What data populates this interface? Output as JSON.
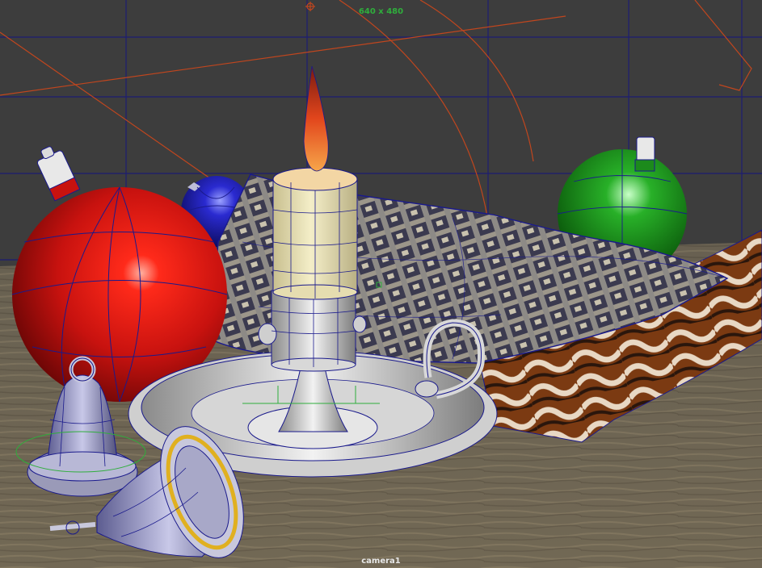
{
  "viewport": {
    "resolution_gate_label": "640 x 480",
    "camera_label": "camera1"
  },
  "colors": {
    "background": "#3d3d3d",
    "grid": "#1d1d73",
    "wireframe": "#1a1a8c",
    "orange_curves": "#c0461e",
    "ornament_red": "#c8120f",
    "ornament_blue": "#2222b8",
    "ornament_green": "#1a8a1a",
    "candle_wax": "#efe6b8",
    "flame": "#e2461c",
    "floor_wood": "#6b6252",
    "metal": "#e4e4e4"
  },
  "scene_objects": [
    "red-ornament",
    "blue-ornament",
    "green-ornament",
    "candle",
    "flame",
    "candle-holder",
    "bell-left",
    "bell-front",
    "plaid-cloth",
    "ribbon-cloth",
    "wood-floor"
  ]
}
